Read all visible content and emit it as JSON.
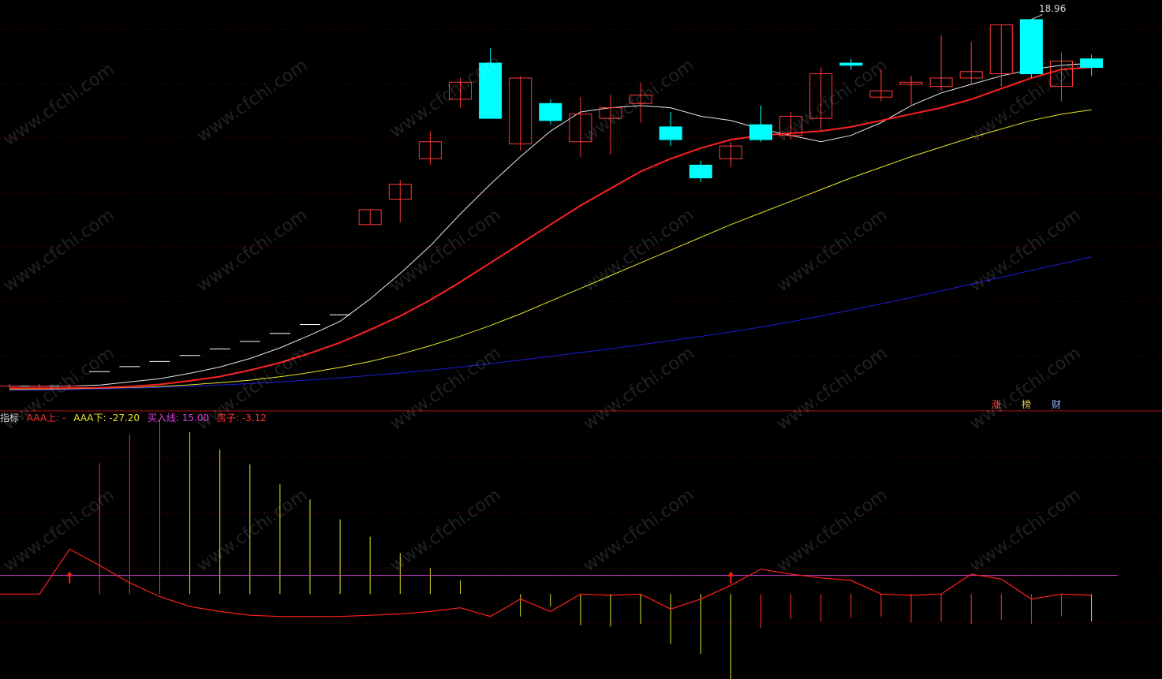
{
  "chart_data": [
    {
      "type": "candlestick",
      "title": "",
      "high_label": "18.96",
      "ylim": [
        1.5,
        19.5
      ],
      "n_bars": 37,
      "candles": [
        {
          "o": 1.7,
          "h": 1.8,
          "l": 1.6,
          "c": 1.7
        },
        {
          "o": 1.7,
          "h": 1.8,
          "l": 1.6,
          "c": 1.7
        },
        {
          "o": 1.7,
          "h": 1.8,
          "l": 1.6,
          "c": 1.7
        },
        {
          "o": 2.38,
          "h": 2.38,
          "l": 2.38,
          "c": 2.38
        },
        {
          "o": 2.62,
          "h": 2.62,
          "l": 2.62,
          "c": 2.62
        },
        {
          "o": 2.86,
          "h": 2.86,
          "l": 2.86,
          "c": 2.86
        },
        {
          "o": 3.14,
          "h": 3.14,
          "l": 3.14,
          "c": 3.14
        },
        {
          "o": 3.45,
          "h": 3.45,
          "l": 3.45,
          "c": 3.45
        },
        {
          "o": 3.8,
          "h": 3.8,
          "l": 3.8,
          "c": 3.8
        },
        {
          "o": 4.18,
          "h": 4.18,
          "l": 4.18,
          "c": 4.18
        },
        {
          "o": 4.6,
          "h": 4.6,
          "l": 4.6,
          "c": 4.6
        },
        {
          "o": 5.06,
          "h": 5.06,
          "l": 5.06,
          "c": 5.06
        },
        {
          "o": 9.3,
          "h": 10.0,
          "l": 9.3,
          "c": 10.0
        },
        {
          "o": 10.5,
          "h": 11.4,
          "l": 9.4,
          "c": 11.2
        },
        {
          "o": 12.4,
          "h": 13.7,
          "l": 12.1,
          "c": 13.2
        },
        {
          "o": 15.2,
          "h": 16.2,
          "l": 14.8,
          "c": 16.0
        },
        {
          "o": 16.9,
          "h": 17.6,
          "l": 14.3,
          "c": 14.3
        },
        {
          "o": 13.1,
          "h": 16.3,
          "l": 12.8,
          "c": 16.2
        },
        {
          "o": 15.0,
          "h": 15.2,
          "l": 14.0,
          "c": 14.2
        },
        {
          "o": 13.2,
          "h": 15.3,
          "l": 12.5,
          "c": 14.5
        },
        {
          "o": 14.3,
          "h": 15.4,
          "l": 12.6,
          "c": 14.8
        },
        {
          "o": 15.0,
          "h": 16.0,
          "l": 14.1,
          "c": 15.4
        },
        {
          "o": 13.9,
          "h": 14.6,
          "l": 13.0,
          "c": 13.3
        },
        {
          "o": 12.1,
          "h": 12.3,
          "l": 11.3,
          "c": 11.5
        },
        {
          "o": 12.4,
          "h": 13.2,
          "l": 12.0,
          "c": 13.0
        },
        {
          "o": 14.0,
          "h": 14.9,
          "l": 13.2,
          "c": 13.3
        },
        {
          "o": 13.5,
          "h": 14.6,
          "l": 13.3,
          "c": 14.4
        },
        {
          "o": 14.3,
          "h": 16.7,
          "l": 13.7,
          "c": 16.4
        },
        {
          "o": 16.9,
          "h": 17.1,
          "l": 16.6,
          "c": 16.8
        },
        {
          "o": 15.3,
          "h": 16.6,
          "l": 15.1,
          "c": 15.6
        },
        {
          "o": 15.9,
          "h": 16.3,
          "l": 14.9,
          "c": 16.0
        },
        {
          "o": 15.8,
          "h": 18.2,
          "l": 15.6,
          "c": 16.2
        },
        {
          "o": 16.2,
          "h": 17.9,
          "l": 15.9,
          "c": 16.5
        },
        {
          "o": 16.4,
          "h": 18.7,
          "l": 15.8,
          "c": 18.7
        },
        {
          "o": 18.95,
          "h": 18.96,
          "l": 16.2,
          "c": 16.4
        },
        {
          "o": 15.8,
          "h": 17.4,
          "l": 15.1,
          "c": 17.0
        },
        {
          "o": 17.1,
          "h": 17.3,
          "l": 16.3,
          "c": 16.7
        }
      ],
      "series": [
        {
          "color": "#e8e8e8",
          "values": [
            1.7,
            1.7,
            1.7,
            1.75,
            1.9,
            2.05,
            2.3,
            2.6,
            3.0,
            3.5,
            4.1,
            4.75,
            5.8,
            7.0,
            8.3,
            9.8,
            11.2,
            12.5,
            13.7,
            14.6,
            14.8,
            14.9,
            14.8,
            14.4,
            14.2,
            13.8,
            13.5,
            13.2,
            13.5,
            14.1,
            14.9,
            15.5,
            15.9,
            16.3,
            16.6,
            16.8,
            16.9
          ]
        },
        {
          "color": "#ff2020",
          "values": [
            1.6,
            1.6,
            1.6,
            1.62,
            1.68,
            1.78,
            1.95,
            2.15,
            2.45,
            2.8,
            3.25,
            3.75,
            4.35,
            5.0,
            5.75,
            6.6,
            7.5,
            8.4,
            9.3,
            10.2,
            11.0,
            11.8,
            12.4,
            12.9,
            13.3,
            13.5,
            13.6,
            13.7,
            13.9,
            14.2,
            14.5,
            14.8,
            15.2,
            15.7,
            16.2,
            16.6,
            16.7
          ]
        },
        {
          "color": "#e6e62a",
          "values": [
            1.55,
            1.55,
            1.56,
            1.58,
            1.62,
            1.68,
            1.76,
            1.86,
            1.98,
            2.14,
            2.34,
            2.58,
            2.86,
            3.2,
            3.6,
            4.05,
            4.55,
            5.1,
            5.7,
            6.3,
            6.9,
            7.5,
            8.1,
            8.7,
            9.3,
            9.85,
            10.4,
            10.95,
            11.5,
            12.0,
            12.5,
            12.95,
            13.4,
            13.8,
            14.2,
            14.5,
            14.7
          ]
        },
        {
          "color": "#1c1cd6",
          "values": [
            1.5,
            1.52,
            1.54,
            1.57,
            1.6,
            1.64,
            1.69,
            1.75,
            1.82,
            1.9,
            1.99,
            2.09,
            2.2,
            2.32,
            2.45,
            2.6,
            2.76,
            2.93,
            3.1,
            3.28,
            3.46,
            3.65,
            3.84,
            4.04,
            4.25,
            4.48,
            4.73,
            5.0,
            5.28,
            5.57,
            5.87,
            6.18,
            6.5,
            6.82,
            7.14,
            7.46,
            7.78
          ]
        }
      ],
      "badges": [
        {
          "label": "涨",
          "color": "#ff4444"
        },
        {
          "label": "榜",
          "color": "#e6c84a"
        },
        {
          "label": "财",
          "color": "#8fb8ff"
        }
      ]
    },
    {
      "type": "bar+line",
      "legend": [
        {
          "label": "指标",
          "value": "",
          "color": "#d8d8d8"
        },
        {
          "label": "AAA上:",
          "value": "-",
          "color": "#ff3030"
        },
        {
          "label": "AAA下:",
          "value": "-27.20",
          "color": "#e6e62a"
        },
        {
          "label": "买入线:",
          "value": "15.00",
          "color": "#e040e0"
        },
        {
          "label": "房子:",
          "value": "-3.12",
          "color": "#ff3030"
        }
      ],
      "ylim": [
        -65,
        135
      ],
      "buy_line": 15.0,
      "bars": [
        null,
        null,
        null,
        105,
        128,
        140,
        130,
        116,
        104,
        88,
        76,
        60,
        46,
        33,
        21,
        11,
        null,
        -18,
        -10,
        -25,
        -26,
        -24,
        -40,
        -48,
        -69,
        -27,
        -20,
        -22,
        -19,
        -18,
        -23,
        -22,
        -24,
        -21,
        -24,
        -18,
        -22
      ],
      "bar_colors": [
        "",
        "",
        "",
        "red",
        "red",
        "red",
        "yellow",
        "yellow",
        "yellow",
        "yellow",
        "yellow",
        "yellow",
        "yellow",
        "yellow",
        "yellow",
        "yellow",
        "",
        "yellow",
        "yellow",
        "yellow",
        "yellow",
        "yellow",
        "yellow",
        "yellow",
        "yellow",
        "red",
        "red",
        "red",
        "red",
        "red",
        "red",
        "red",
        "red",
        "red",
        "red",
        "red",
        "yellow"
      ],
      "line": {
        "color": "#ff2020",
        "values": [
          0,
          0,
          36,
          23,
          9,
          -2,
          -10,
          -14,
          -17,
          -18,
          -18,
          -18,
          -17,
          -16,
          -14,
          -11,
          -18,
          -4,
          -14,
          0,
          -1,
          0,
          -12,
          -4,
          7,
          20,
          16,
          13,
          11,
          0,
          -1,
          0,
          16,
          12,
          -4,
          0,
          -1
        ]
      },
      "arrows": [
        2,
        24
      ]
    }
  ],
  "watermark": "www.cfchi.com"
}
